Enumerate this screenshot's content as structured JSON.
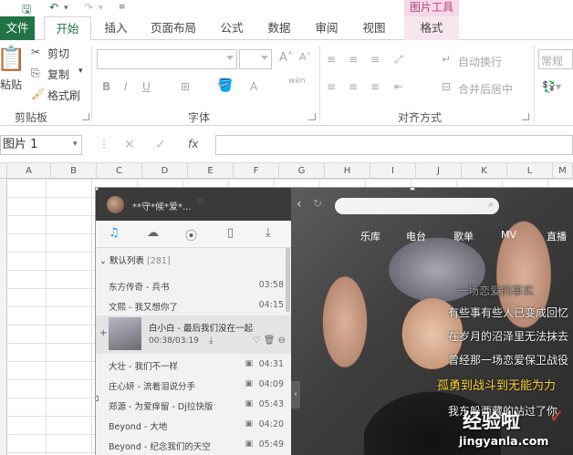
{
  "quick_access": {
    "save_icon": "save-icon",
    "undo_icon": "undo-icon",
    "redo_icon": "redo-icon"
  },
  "contextual_group": "图片工具",
  "tabs": [
    "文件",
    "开始",
    "插入",
    "页面布局",
    "公式",
    "数据",
    "审阅",
    "视图",
    "格式"
  ],
  "clipboard": {
    "paste": "粘贴",
    "cut": "剪切",
    "copy": "复制",
    "format_painter": "格式刷",
    "group": "剪贴板"
  },
  "font": {
    "bold": "B",
    "italic": "I",
    "underline": "U",
    "wen": "wén",
    "group": "字体"
  },
  "alignment": {
    "wrap": "自动换行",
    "merge": "合并后居中",
    "group": "对齐方式"
  },
  "number": {
    "format": "常规"
  },
  "formula_bar": {
    "name_box": "图片 1",
    "fx": "fx",
    "value": ""
  },
  "columns": [
    "A",
    "B",
    "C",
    "D",
    "E",
    "F",
    "G",
    "H",
    "I",
    "J",
    "K",
    "L",
    "M"
  ],
  "player": {
    "username": "**守*候*爱*...",
    "list_title": "默认列表",
    "list_count": "[281]",
    "songs_top": [
      {
        "title": "东方传奇 - 兵书",
        "duration": "03:58"
      },
      {
        "title": "文熙 - 我又想你了",
        "duration": "04:15"
      }
    ],
    "active": {
      "title": "白小白 - 最后我们没在一起",
      "time": "00:38/03:19"
    },
    "songs_bottom": [
      {
        "title": "大壮 - 我们不一样",
        "duration": "04:31"
      },
      {
        "title": "庄心妍 - 流着泪说分手",
        "duration": "04:09"
      },
      {
        "title": "郑源 - 为爱痒留 - Dj拉快版",
        "duration": "05:43"
      },
      {
        "title": "Beyond - 大地",
        "duration": "04:20"
      },
      {
        "title": "Beyond - 纪念我们的天空",
        "duration": "05:49"
      }
    ],
    "categories": [
      "乐库",
      "电台",
      "歌单",
      "MV",
      "直播"
    ],
    "lyrics": [
      "一场恋爱的事实",
      "有些事有些人已变成回忆",
      "在岁月的沼泽里无法抹去",
      "曾经那一场恋爱保卫战役",
      "孤勇到战斗到无能为力",
      "我东躲西藏的站过了你"
    ]
  },
  "watermark": {
    "main": "经验啦",
    "check": "✓",
    "url": "jingyanla.com"
  }
}
